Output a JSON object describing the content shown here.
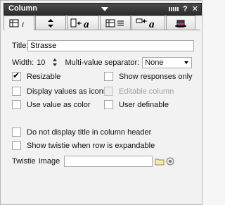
{
  "window": {
    "title": "Column"
  },
  "tabs": [
    {
      "icon": "column-info-icon",
      "active": true
    },
    {
      "icon": "sort-icon"
    },
    {
      "icon": "column-font-icon"
    },
    {
      "icon": "column-title-style-icon"
    },
    {
      "icon": "title-font-icon"
    },
    {
      "icon": "advanced-hat-icon"
    }
  ],
  "form": {
    "title_label": "Title:",
    "title_value": "Strasse",
    "width_label": "Width:",
    "width_value": "10",
    "separator_label": "Multi-value separator:",
    "separator_value": "None",
    "resizable": "Resizable",
    "show_responses_only": "Show responses only",
    "display_icons": "Display values as icons",
    "editable_column": "Editable column",
    "value_as_color": "Use value as color",
    "user_definable": "User definable",
    "no_title_header": "Do not display title in column header",
    "show_twistie": "Show twistie when row is expandable",
    "twistie_label": "Twistie",
    "image_label": "Image",
    "image_value": ""
  }
}
